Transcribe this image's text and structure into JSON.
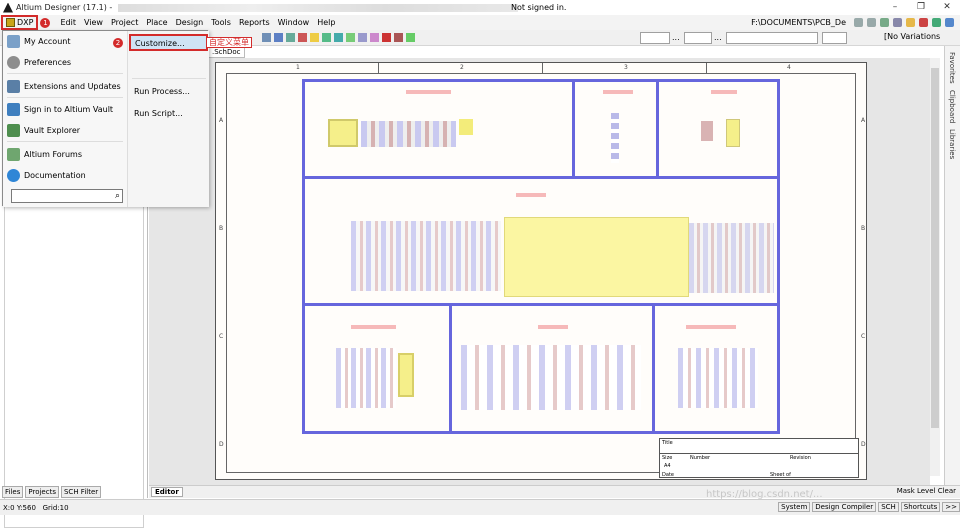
{
  "titlebar": {
    "app_title": "Altium Designer (17.1) -",
    "signin_status": "Not signed in.",
    "minimize": "–",
    "restore": "❐",
    "close": "✕"
  },
  "menubar": {
    "dxp_label": "DXP",
    "items": [
      "Edit",
      "View",
      "Project",
      "Place",
      "Design",
      "Tools",
      "Reports",
      "Window",
      "Help"
    ],
    "path": "F:\\DOCUMENTS\\PCB_De"
  },
  "toolbar": {
    "variations": "[No Variations",
    "combo_dots": "..."
  },
  "dxp_menu": {
    "items": [
      {
        "label": "My Account",
        "icon": "user-icon"
      },
      {
        "label": "Preferences",
        "icon": "gear-icon"
      },
      {
        "label": "Extensions and Updates",
        "icon": "extensions-icon"
      },
      {
        "label": "Sign in to Altium Vault",
        "icon": "vault-signin-icon"
      },
      {
        "label": "Vault Explorer",
        "icon": "vault-explorer-icon"
      },
      {
        "label": "Altium Forums",
        "icon": "forums-icon"
      },
      {
        "label": "Documentation",
        "icon": "help-icon"
      }
    ],
    "commands": [
      "Customize...",
      "Run Process...",
      "Run Script..."
    ],
    "search_icon": "⌕"
  },
  "annotations": {
    "badge1": "1",
    "badge2": "2",
    "customize_note": "自定义菜单"
  },
  "document": {
    "tab_label": ".SchDoc",
    "zones_top": [
      "1",
      "2",
      "3",
      "4"
    ],
    "zones_left": [
      "A",
      "B",
      "C",
      "D"
    ],
    "titleblock": {
      "title": "Title",
      "size": "Size",
      "size_value": "A4",
      "number": "Number",
      "revision": "Revision",
      "date": "Date",
      "sheet": "Sheet   of"
    }
  },
  "left_panel": {
    "tabs": [
      "Files",
      "Projects",
      "SCH Filter"
    ]
  },
  "right_panel": {
    "tabs": [
      "Favorites",
      "Clipboard",
      "Libraries"
    ]
  },
  "editor": {
    "tab": "Editor",
    "mask_level": "Mask Level",
    "clear": "Clear"
  },
  "statusbar": {
    "coords": "X:0 Y:560",
    "grid": "Grid:10",
    "tabs": [
      "System",
      "Design Compiler",
      "SCH",
      "Shortcuts",
      ">>"
    ]
  },
  "watermark": "https://blog.csdn.net/..."
}
